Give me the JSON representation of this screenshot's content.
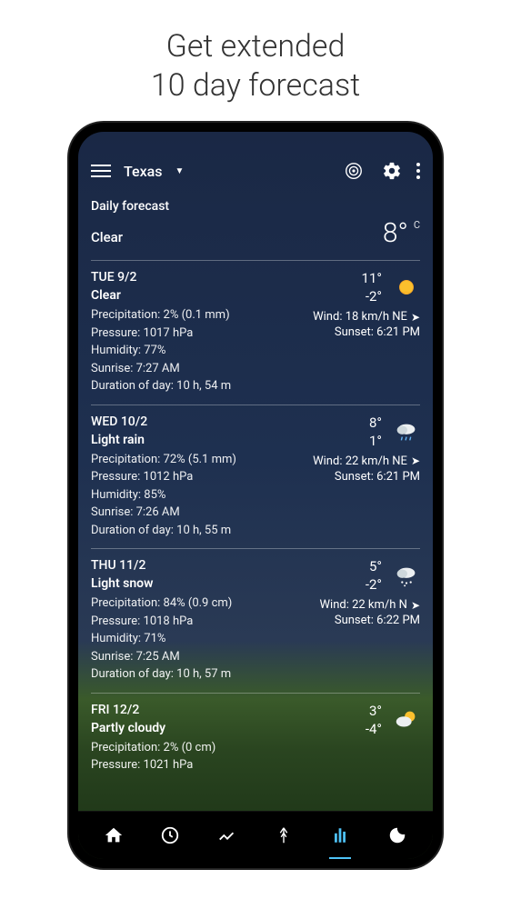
{
  "promo": {
    "line1": "Get extended",
    "line2": "10 day forecast"
  },
  "header": {
    "location": "Texas",
    "daily_label": "Daily forecast",
    "current_condition": "Clear",
    "current_temp": "8°",
    "temp_unit": "C"
  },
  "days": [
    {
      "date": "TUE 9/2",
      "condition": "Clear",
      "precipitation": "Precipitation: 2% (0.1 mm)",
      "pressure": "Pressure: 1017 hPa",
      "humidity": "Humidity: 77%",
      "sunrise": "Sunrise: 7:27 AM",
      "duration": "Duration of day: 10 h, 54 m",
      "high": "11°",
      "low": "-2°",
      "wind": "Wind: 18 km/h NE",
      "sunset": "Sunset: 6:21 PM",
      "icon": "sun"
    },
    {
      "date": "WED 10/2",
      "condition": "Light rain",
      "precipitation": "Precipitation: 72% (5.1 mm)",
      "pressure": "Pressure: 1012 hPa",
      "humidity": "Humidity: 85%",
      "sunrise": "Sunrise: 7:26 AM",
      "duration": "Duration of day: 10 h, 55 m",
      "high": "8°",
      "low": "1°",
      "wind": "Wind: 22 km/h NE",
      "sunset": "Sunset: 6:21 PM",
      "icon": "rain"
    },
    {
      "date": "THU 11/2",
      "condition": "Light snow",
      "precipitation": "Precipitation: 84% (0.9 cm)",
      "pressure": "Pressure: 1018 hPa",
      "humidity": "Humidity: 71%",
      "sunrise": "Sunrise: 7:25 AM",
      "duration": "Duration of day: 10 h, 57 m",
      "high": "5°",
      "low": "-2°",
      "wind": "Wind: 22 km/h N",
      "sunset": "Sunset: 6:22 PM",
      "icon": "snow"
    },
    {
      "date": "FRI 12/2",
      "condition": "Partly cloudy",
      "precipitation": "Precipitation: 2% (0 cm)",
      "pressure": "Pressure: 1021 hPa",
      "humidity": "",
      "sunrise": "",
      "duration": "",
      "high": "3°",
      "low": "-4°",
      "wind": "",
      "sunset": "",
      "icon": "partly"
    }
  ]
}
